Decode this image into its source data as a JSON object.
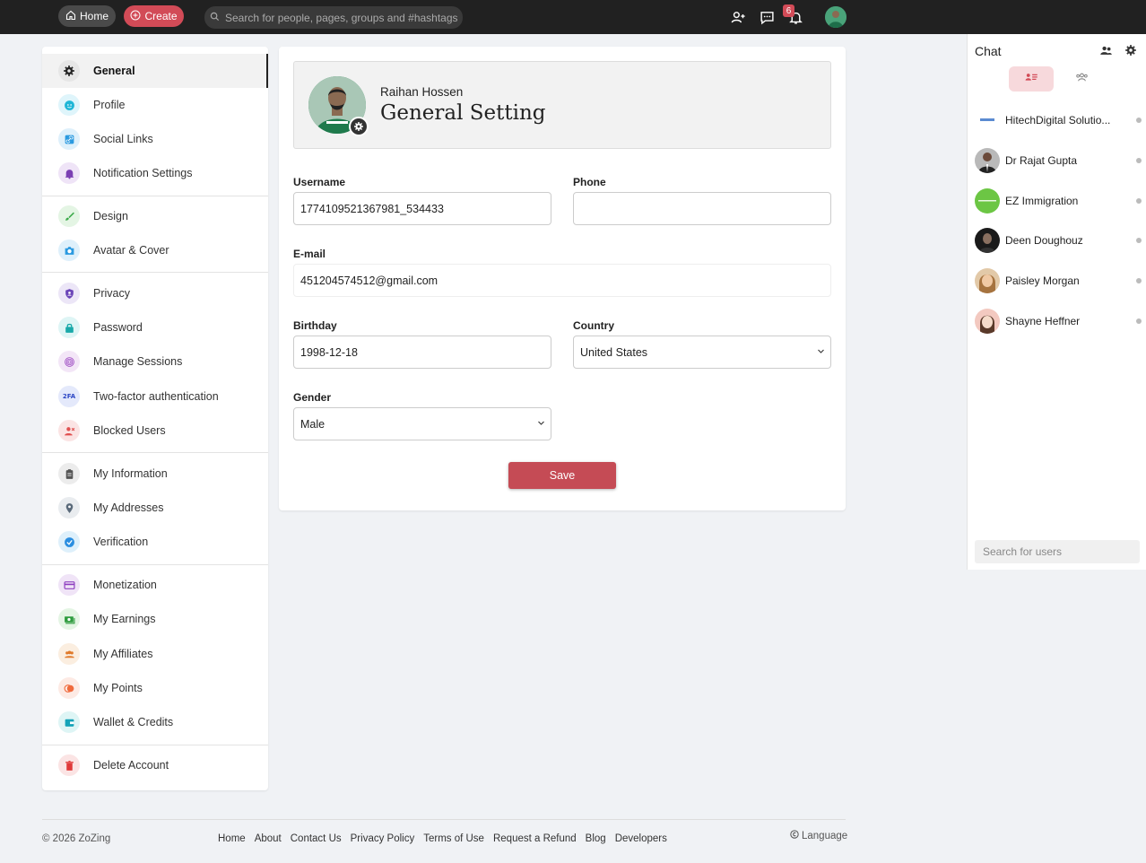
{
  "topbar": {
    "home_label": "Home",
    "create_label": "Create",
    "search_placeholder": "Search for people, pages, groups and #hashtags",
    "notification_count": "6"
  },
  "menu": {
    "items": [
      {
        "label": "General",
        "icon": "gear-icon",
        "active": true
      },
      {
        "label": "Profile",
        "icon": "face-icon"
      },
      {
        "label": "Social Links",
        "icon": "link-icon"
      },
      {
        "label": "Notification Settings",
        "icon": "bell-icon"
      },
      {
        "label": "Design",
        "icon": "brush-icon"
      },
      {
        "label": "Avatar & Cover",
        "icon": "camera-icon"
      },
      {
        "label": "Privacy",
        "icon": "shield-user-icon"
      },
      {
        "label": "Password",
        "icon": "lock-icon"
      },
      {
        "label": "Manage Sessions",
        "icon": "fingerprint-icon"
      },
      {
        "label": "Two-factor authentication",
        "icon": "2fa-icon"
      },
      {
        "label": "Blocked Users",
        "icon": "block-user-icon"
      },
      {
        "label": "My Information",
        "icon": "clipboard-icon"
      },
      {
        "label": "My Addresses",
        "icon": "location-pin-icon"
      },
      {
        "label": "Verification",
        "icon": "verified-badge-icon"
      },
      {
        "label": "Monetization",
        "icon": "credit-card-icon"
      },
      {
        "label": "My Earnings",
        "icon": "money-icon"
      },
      {
        "label": "My Affiliates",
        "icon": "group-icon"
      },
      {
        "label": "My Points",
        "icon": "points-icon"
      },
      {
        "label": "Wallet & Credits",
        "icon": "wallet-icon"
      },
      {
        "label": "Delete Account",
        "icon": "trash-icon"
      }
    ]
  },
  "header": {
    "name": "Raihan Hossen",
    "title": "General Setting"
  },
  "form": {
    "username_label": "Username",
    "username_value": "1774109521367981_534433",
    "phone_label": "Phone",
    "phone_value": "",
    "email_label": "E-mail",
    "email_value": "451204574512@gmail.com",
    "birthday_label": "Birthday",
    "birthday_value": "1998-12-18",
    "country_label": "Country",
    "country_value": "United States",
    "gender_label": "Gender",
    "gender_value": "Male",
    "save_label": "Save"
  },
  "chat": {
    "title": "Chat",
    "search_placeholder": "Search for users",
    "users": [
      {
        "name": "HitechDigital Solutio..."
      },
      {
        "name": "Dr Rajat Gupta"
      },
      {
        "name": "EZ Immigration"
      },
      {
        "name": "Deen Doughouz"
      },
      {
        "name": "Paisley Morgan"
      },
      {
        "name": "Shayne Heffner"
      }
    ]
  },
  "footer": {
    "copyright": "© 2026 ZoZing",
    "links": [
      "Home",
      "About",
      "Contact Us",
      "Privacy Policy",
      "Terms of Use",
      "Request a Refund",
      "Blog",
      "Developers"
    ],
    "language": "Language"
  },
  "colors": {
    "accent": "#d24b57",
    "topbar": "#212121",
    "save": "#c54b55"
  }
}
